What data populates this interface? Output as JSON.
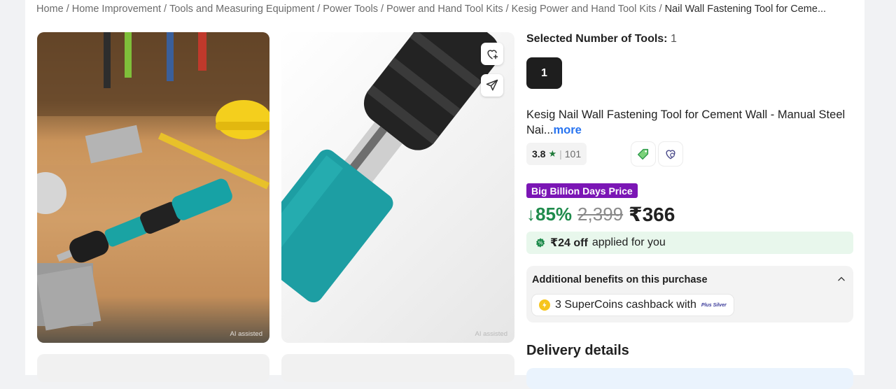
{
  "breadcrumb": {
    "items": [
      "Home",
      "Home Improvement",
      "Tools and Measuring Equipment",
      "Power Tools",
      "Power and Hand Tool Kits",
      "Kesig Power and Hand Tool Kits"
    ],
    "current": "Nail Wall Fastening Tool for Ceme..."
  },
  "gallery": {
    "ai_tag_left": "AI assisted",
    "ai_tag_right": "AI assisted",
    "icons": [
      "heart-plus-icon",
      "share-icon"
    ]
  },
  "selection": {
    "label": "Selected Number of Tools:",
    "value": "1",
    "chip": "1"
  },
  "product": {
    "title": "Kesig Nail Wall Fastening Tool for Cement Wall - Manual Steel Nai...",
    "more": "more"
  },
  "rating": {
    "score": "3.8",
    "star": "★",
    "count": "101"
  },
  "pricing": {
    "badge": "Big Billion Days Price",
    "discount": "↓85%",
    "mrp": "2,399",
    "price": "₹366"
  },
  "offer": {
    "amount": "₹24 off",
    "text": "applied for you"
  },
  "benefits": {
    "heading": "Additional benefits on this purchase",
    "coins": "3 SuperCoins cashback with",
    "tier": "Plus Silver"
  },
  "delivery": {
    "title": "Delivery details"
  },
  "colors": {
    "accent_blue": "#2874f0",
    "discount_green": "#1f8b4c",
    "bbd_purple": "#7b16b5",
    "offer_bg": "#e8f7ec"
  }
}
